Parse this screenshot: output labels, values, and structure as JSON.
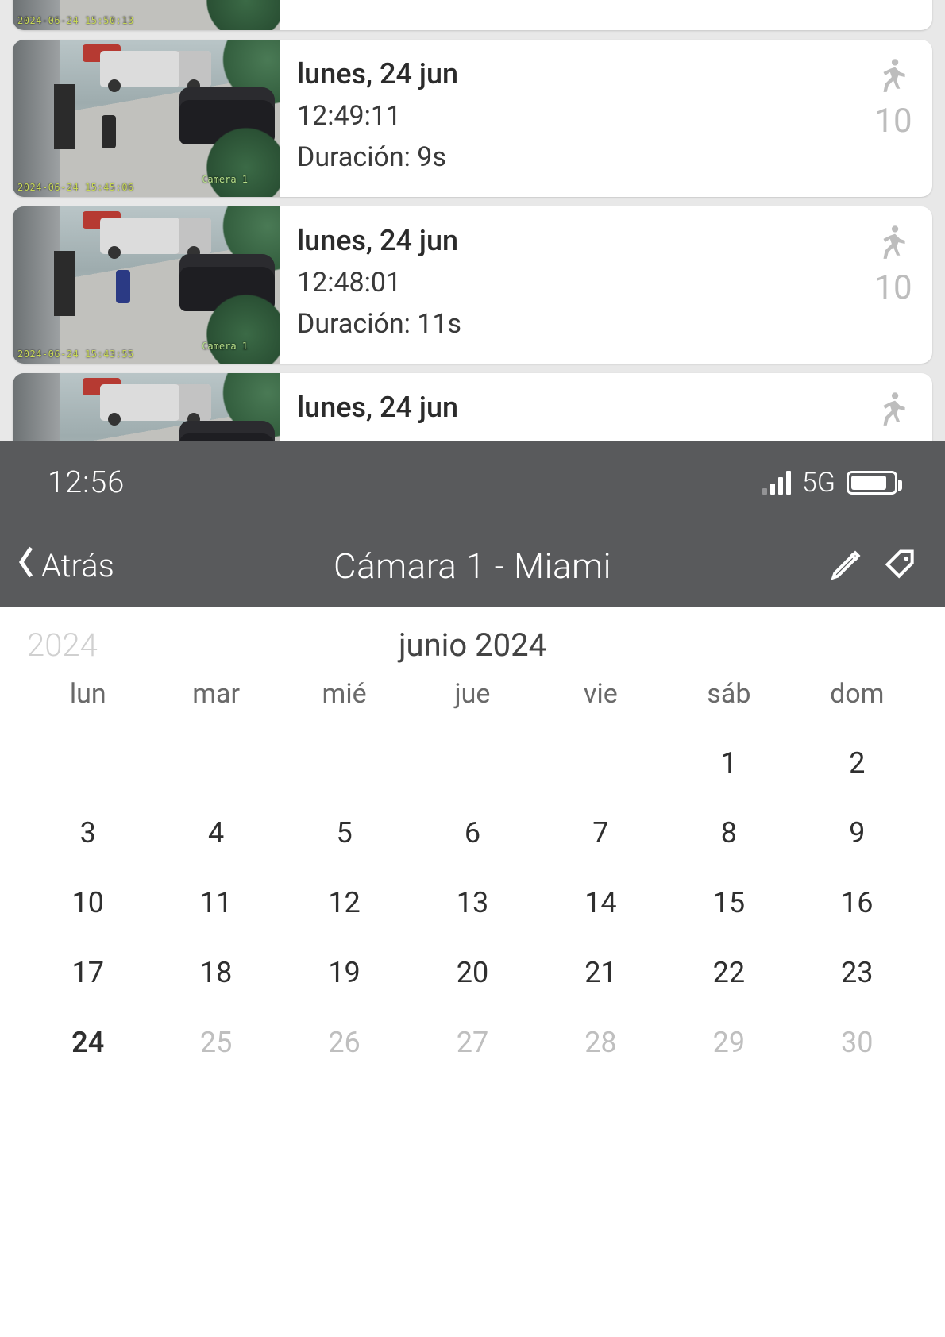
{
  "events": [
    {
      "date": "lunes, 24 jun",
      "time": "12:49:11",
      "duration": "Duración: 9s",
      "motion_count": "10",
      "overlay_ts": "2024-06-24 15:45:06",
      "overlay_cam": "Camera 1"
    },
    {
      "date": "lunes, 24 jun",
      "time": "12:48:01",
      "duration": "Duración: 11s",
      "motion_count": "10",
      "overlay_ts": "2024-06-24 15:43:55",
      "overlay_cam": "Camera 1"
    },
    {
      "date": "lunes, 24 jun",
      "time": "",
      "duration": "",
      "motion_count": "",
      "overlay_ts": "",
      "overlay_cam": ""
    }
  ],
  "events_partial_top": {
    "overlay_ts": "2024-06-24 15:50:13"
  },
  "status": {
    "time": "12:56",
    "network": "5G"
  },
  "nav": {
    "back": "Atrás",
    "title": "Cámara 1 - Miami"
  },
  "calendar": {
    "prev_year": "2024",
    "month_label": "junio 2024",
    "dow": [
      "lun",
      "mar",
      "mié",
      "jue",
      "vie",
      "sáb",
      "dom"
    ],
    "days": [
      {
        "n": "",
        "cls": "empty"
      },
      {
        "n": "",
        "cls": "empty"
      },
      {
        "n": "",
        "cls": "empty"
      },
      {
        "n": "",
        "cls": "empty"
      },
      {
        "n": "",
        "cls": "empty"
      },
      {
        "n": "1"
      },
      {
        "n": "2"
      },
      {
        "n": "3"
      },
      {
        "n": "4"
      },
      {
        "n": "5"
      },
      {
        "n": "6"
      },
      {
        "n": "7"
      },
      {
        "n": "8"
      },
      {
        "n": "9"
      },
      {
        "n": "10"
      },
      {
        "n": "11"
      },
      {
        "n": "12"
      },
      {
        "n": "13"
      },
      {
        "n": "14"
      },
      {
        "n": "15"
      },
      {
        "n": "16"
      },
      {
        "n": "17"
      },
      {
        "n": "18"
      },
      {
        "n": "19"
      },
      {
        "n": "20"
      },
      {
        "n": "21"
      },
      {
        "n": "22"
      },
      {
        "n": "23"
      },
      {
        "n": "24",
        "cls": "today"
      },
      {
        "n": "25",
        "cls": "disabled"
      },
      {
        "n": "26",
        "cls": "disabled"
      },
      {
        "n": "27",
        "cls": "disabled"
      },
      {
        "n": "28",
        "cls": "disabled"
      },
      {
        "n": "29",
        "cls": "disabled"
      },
      {
        "n": "30",
        "cls": "disabled"
      }
    ]
  }
}
